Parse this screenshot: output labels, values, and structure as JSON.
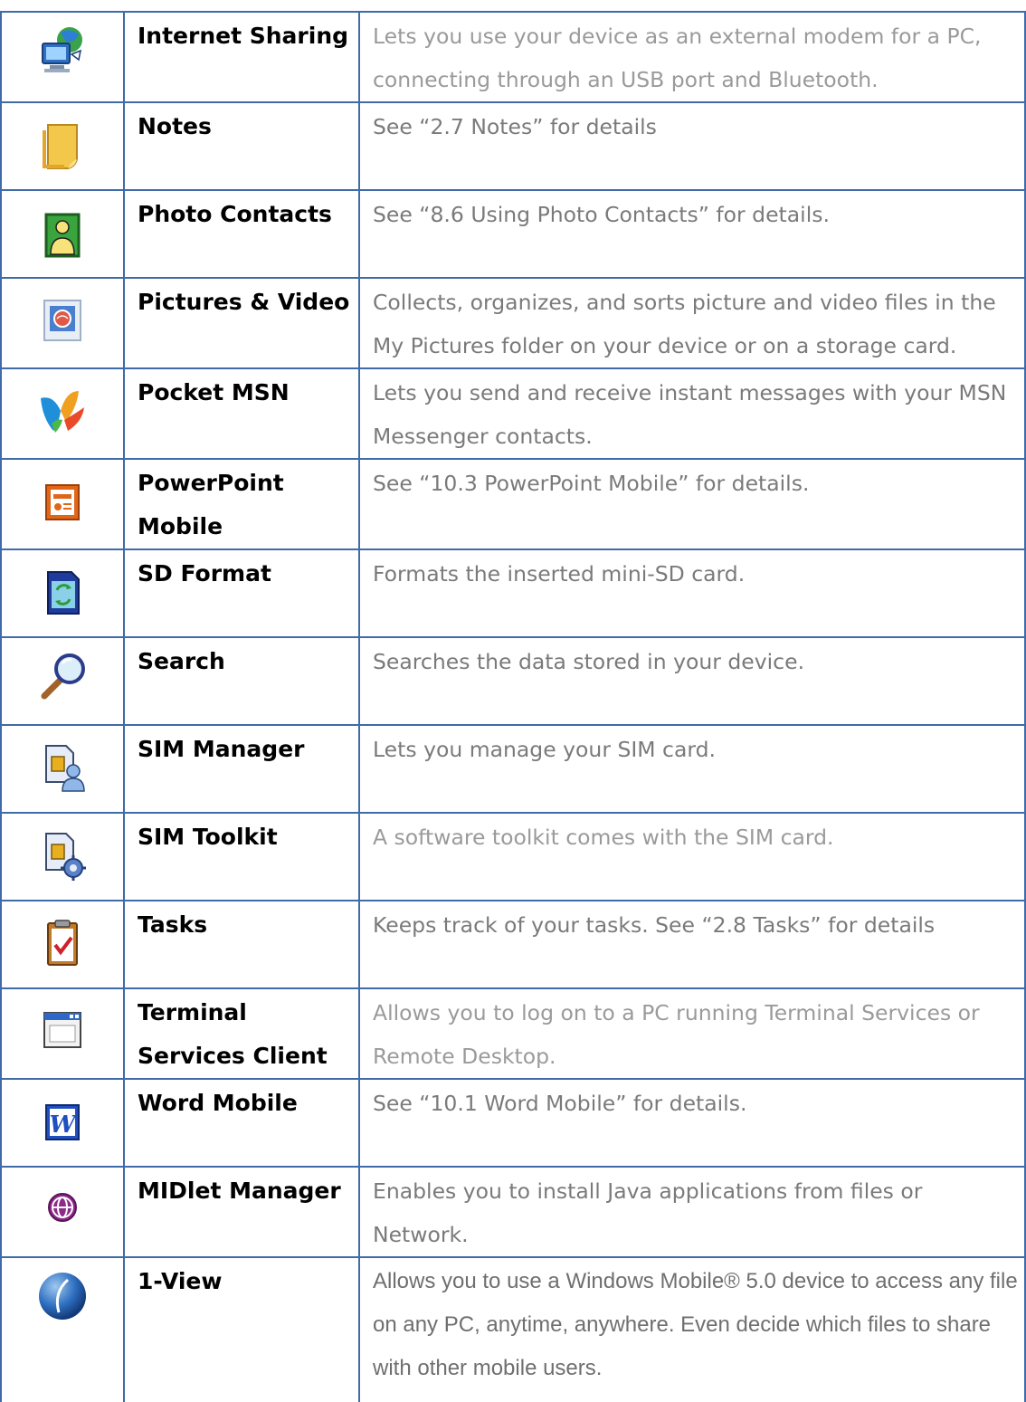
{
  "rows": [
    {
      "name": "Internet Sharing",
      "desc": "Lets you use your device as an external modem for a PC, connecting through an USB port and Bluetooth.",
      "icon": "internet-sharing-icon"
    },
    {
      "name": "Notes",
      "desc": "See “2.7 Notes” for details",
      "icon": "notes-icon"
    },
    {
      "name": "Photo Contacts",
      "desc": "See “8.6 Using Photo Contacts” for details.",
      "icon": "photo-contacts-icon"
    },
    {
      "name": "Pictures & Video",
      "desc": "Collects, organizes, and sorts picture and video files in the My Pictures folder on your device or on a storage card.",
      "icon": "pictures-video-icon"
    },
    {
      "name": "Pocket MSN",
      "desc": "Lets you send and receive instant messages with your MSN Messenger contacts.",
      "icon": "msn-butterfly-icon"
    },
    {
      "name": "PowerPoint Mobile",
      "desc": "See “10.3 PowerPoint Mobile” for details.",
      "icon": "powerpoint-icon"
    },
    {
      "name": "SD Format",
      "desc": "Formats the inserted mini-SD card.",
      "icon": "sd-format-icon"
    },
    {
      "name": "Search",
      "desc": "Searches the data stored in your device.",
      "icon": "magnifier-icon"
    },
    {
      "name": "SIM Manager",
      "desc": "Lets you manage your SIM card.",
      "icon": "sim-manager-icon"
    },
    {
      "name": "SIM Toolkit",
      "desc": "A software toolkit comes with the SIM card.",
      "icon": "sim-toolkit-icon"
    },
    {
      "name": "Tasks",
      "desc": "Keeps track of your tasks. See “2.8 Tasks” for details",
      "icon": "tasks-clipboard-icon"
    },
    {
      "name": "Terminal Services Client",
      "desc": "Allows you to log on to a PC running Terminal Services or Remote Desktop.",
      "icon": "terminal-window-icon"
    },
    {
      "name": "Word Mobile",
      "desc": "See “10.1 Word Mobile” for details.",
      "icon": "word-icon"
    },
    {
      "name": "MIDlet Manager",
      "desc": "Enables you to install Java applications from files or Network.",
      "icon": "globe-icon"
    },
    {
      "name": "1-View",
      "desc": "Allows you to use a Windows Mobile® 5.0 device to access any file on any PC, anytime, anywhere. Even decide which files to share with other mobile users.",
      "icon": "one-view-icon"
    }
  ]
}
